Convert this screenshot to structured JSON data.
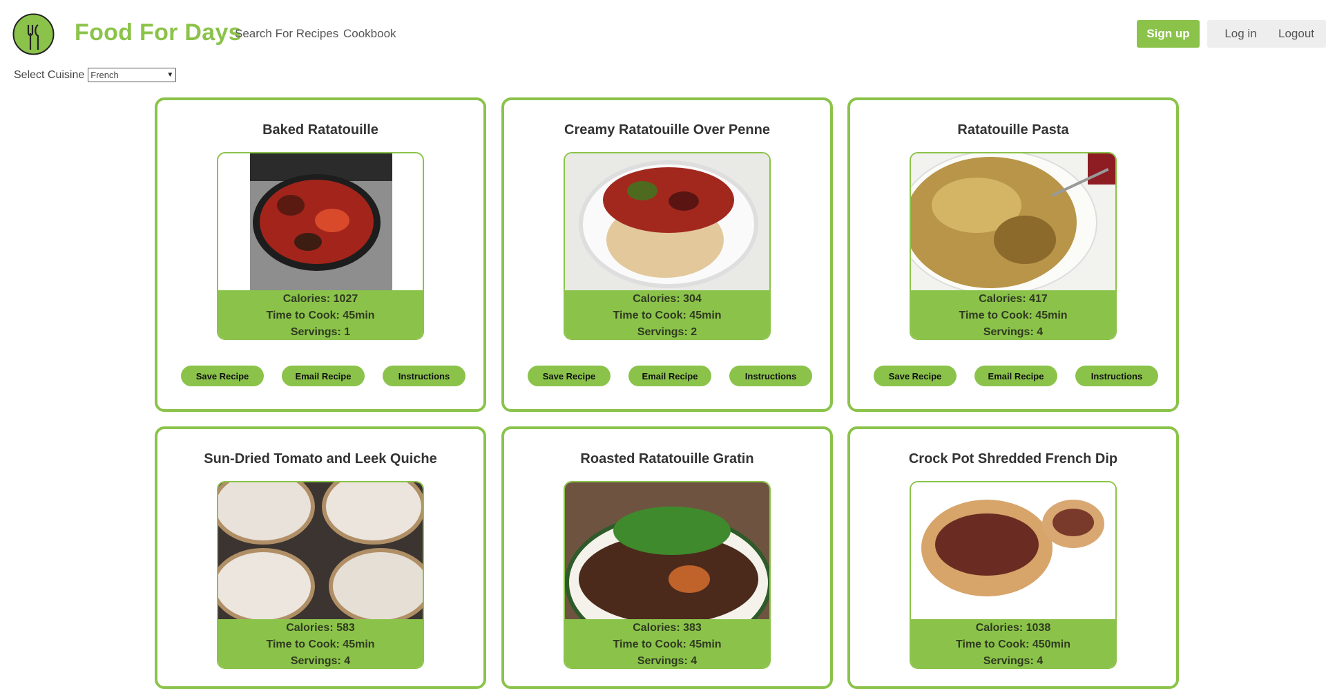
{
  "brand": {
    "name": "Food For Days",
    "logo_icon": "fork-knife-icon",
    "accent": "#8bc34a"
  },
  "nav": {
    "search": "Search For Recipes",
    "cookbook": "Cookbook"
  },
  "auth": {
    "signup": "Sign up",
    "login": "Log in",
    "logout": "Logout"
  },
  "cuisine": {
    "label": "Select Cuisine",
    "selected": "French"
  },
  "buttons": {
    "save": "Save Recipe",
    "email": "Email Recipe",
    "instructions": "Instructions"
  },
  "recipes": [
    {
      "title": "Baked Ratatouille",
      "calories": "Calories: 1027",
      "time": "Time to Cook: 45min",
      "servings": "Servings: 1"
    },
    {
      "title": "Creamy Ratatouille Over Penne",
      "calories": "Calories: 304",
      "time": "Time to Cook: 45min",
      "servings": "Servings: 2"
    },
    {
      "title": "Ratatouille Pasta",
      "calories": "Calories: 417",
      "time": "Time to Cook: 45min",
      "servings": "Servings: 4"
    },
    {
      "title": "Sun-Dried Tomato and Leek Quiche",
      "calories": "Calories: 583",
      "time": "Time to Cook: 45min",
      "servings": "Servings: 4"
    },
    {
      "title": "Roasted Ratatouille Gratin",
      "calories": "Calories: 383",
      "time": "Time to Cook: 45min",
      "servings": "Servings: 4"
    },
    {
      "title": "Crock Pot Shredded French Dip",
      "calories": "Calories: 1038",
      "time": "Time to Cook: 450min",
      "servings": "Servings: 4"
    }
  ]
}
